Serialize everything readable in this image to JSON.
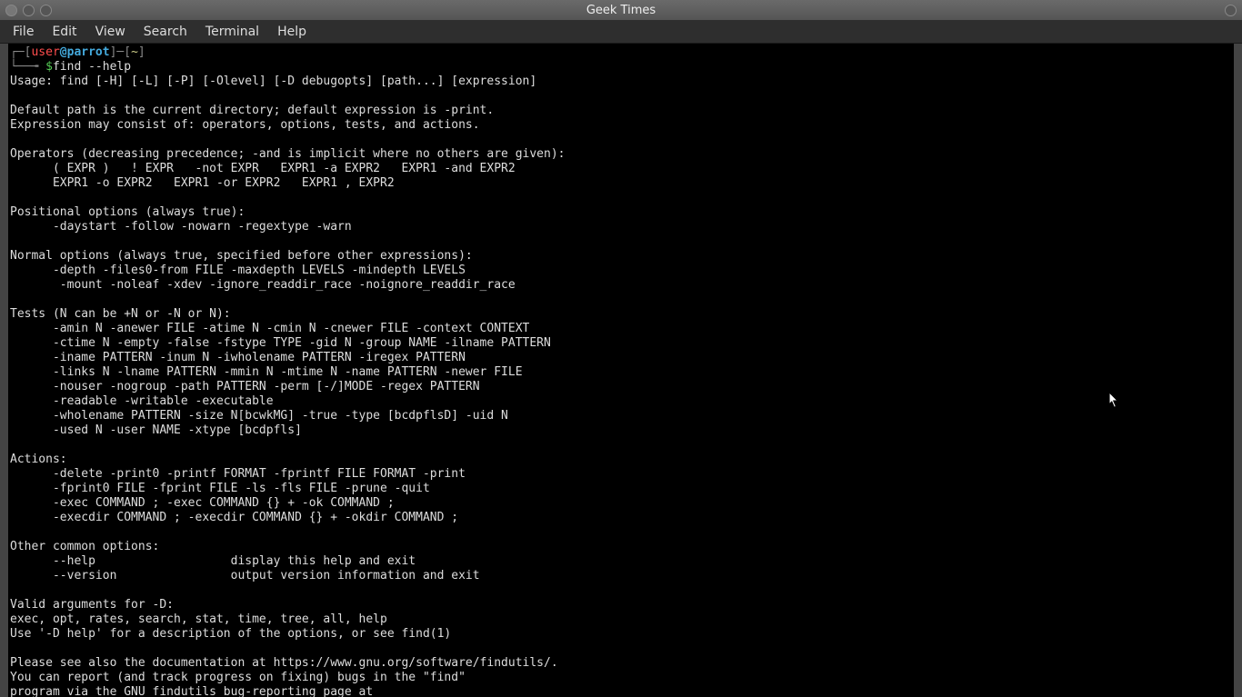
{
  "window": {
    "title": "Geek Times"
  },
  "menu": {
    "file": "File",
    "edit": "Edit",
    "view": "View",
    "search": "Search",
    "terminal": "Terminal",
    "help": "Help"
  },
  "prompt": {
    "lbrack": "┌─[",
    "user": "user",
    "at": "@",
    "host": "parrot",
    "rbrack": "]─[",
    "path": "~",
    "rbrack2": "]",
    "arrow": "└──╼ ",
    "dollar": "$",
    "cmd": "find --help"
  },
  "out": {
    "l01": "Usage: find [-H] [-L] [-P] [-Olevel] [-D debugopts] [path...] [expression]",
    "l02": "",
    "l03": "Default path is the current directory; default expression is -print.",
    "l04": "Expression may consist of: operators, options, tests, and actions.",
    "l05": "",
    "l06": "Operators (decreasing precedence; -and is implicit where no others are given):",
    "l07": "      ( EXPR )   ! EXPR   -not EXPR   EXPR1 -a EXPR2   EXPR1 -and EXPR2",
    "l08": "      EXPR1 -o EXPR2   EXPR1 -or EXPR2   EXPR1 , EXPR2",
    "l09": "",
    "l10": "Positional options (always true):",
    "l11": "      -daystart -follow -nowarn -regextype -warn",
    "l12": "",
    "l13": "Normal options (always true, specified before other expressions):",
    "l14": "      -depth -files0-from FILE -maxdepth LEVELS -mindepth LEVELS",
    "l15": "       -mount -noleaf -xdev -ignore_readdir_race -noignore_readdir_race",
    "l16": "",
    "l17": "Tests (N can be +N or -N or N):",
    "l18": "      -amin N -anewer FILE -atime N -cmin N -cnewer FILE -context CONTEXT",
    "l19": "      -ctime N -empty -false -fstype TYPE -gid N -group NAME -ilname PATTERN",
    "l20": "      -iname PATTERN -inum N -iwholename PATTERN -iregex PATTERN",
    "l21": "      -links N -lname PATTERN -mmin N -mtime N -name PATTERN -newer FILE",
    "l22": "      -nouser -nogroup -path PATTERN -perm [-/]MODE -regex PATTERN",
    "l23": "      -readable -writable -executable",
    "l24": "      -wholename PATTERN -size N[bcwkMG] -true -type [bcdpflsD] -uid N",
    "l25": "      -used N -user NAME -xtype [bcdpfls]",
    "l26": "",
    "l27": "Actions:",
    "l28": "      -delete -print0 -printf FORMAT -fprintf FILE FORMAT -print",
    "l29": "      -fprint0 FILE -fprint FILE -ls -fls FILE -prune -quit",
    "l30": "      -exec COMMAND ; -exec COMMAND {} + -ok COMMAND ;",
    "l31": "      -execdir COMMAND ; -execdir COMMAND {} + -okdir COMMAND ;",
    "l32": "",
    "l33": "Other common options:",
    "l34": "      --help                   display this help and exit",
    "l35": "      --version                output version information and exit",
    "l36": "",
    "l37": "Valid arguments for -D:",
    "l38": "exec, opt, rates, search, stat, time, tree, all, help",
    "l39": "Use '-D help' for a description of the options, or see find(1)",
    "l40": "",
    "l41": "Please see also the documentation at https://www.gnu.org/software/findutils/.",
    "l42": "You can report (and track progress on fixing) bugs in the \"find\"",
    "l43": "program via the GNU findutils bug-reporting page at"
  }
}
